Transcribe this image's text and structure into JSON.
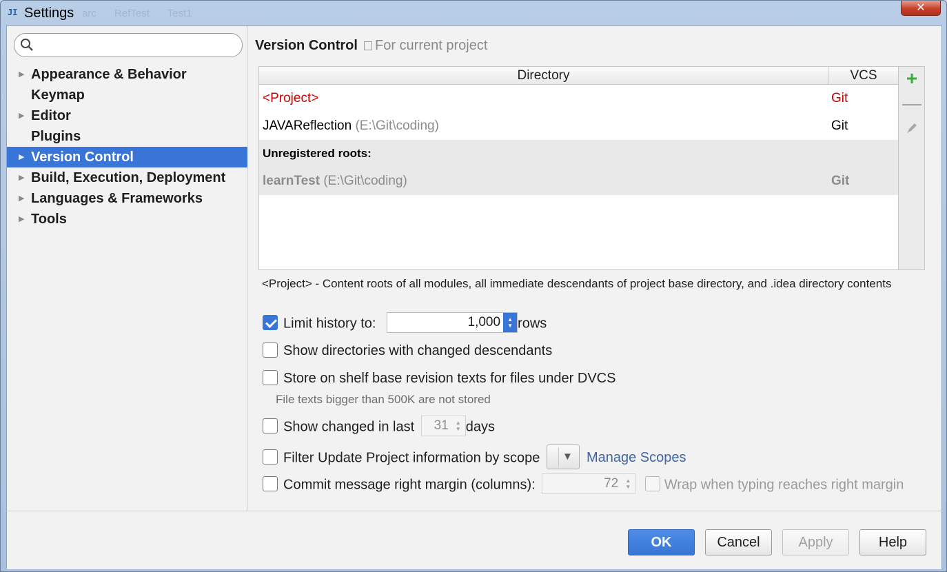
{
  "window": {
    "app_icon": "JI",
    "title": "Settings",
    "background_tabs": [
      "arc",
      "RefTest",
      "Test1"
    ],
    "close_glyph": "✕"
  },
  "sidebar": {
    "search": {
      "value": "",
      "placeholder": ""
    },
    "items": [
      {
        "label": "Appearance & Behavior",
        "expandable": true,
        "selected": false
      },
      {
        "label": "Keymap",
        "expandable": false,
        "selected": false
      },
      {
        "label": "Editor",
        "expandable": true,
        "selected": false
      },
      {
        "label": "Plugins",
        "expandable": false,
        "selected": false
      },
      {
        "label": "Version Control",
        "expandable": true,
        "selected": true
      },
      {
        "label": "Build, Execution, Deployment",
        "expandable": true,
        "selected": false
      },
      {
        "label": "Languages & Frameworks",
        "expandable": true,
        "selected": false
      },
      {
        "label": "Tools",
        "expandable": true,
        "selected": false
      }
    ]
  },
  "main": {
    "heading": "Version Control",
    "scope_label": "For current project",
    "table": {
      "col_directory": "Directory",
      "col_vcs": "VCS",
      "rows": [
        {
          "directory": "<Project>",
          "path": "",
          "vcs": "Git"
        },
        {
          "directory": "JAVAReflection",
          "path": "(E:\\Git\\coding)",
          "vcs": "Git"
        }
      ],
      "unregistered_label": "Unregistered roots:",
      "unregistered_rows": [
        {
          "directory": "learnTest",
          "path": "(E:\\Git\\coding)",
          "vcs": "Git"
        }
      ]
    },
    "table_tools": {
      "add": "+",
      "remove": "—"
    },
    "note": "<Project> - Content roots of all modules, all immediate descendants of project base directory, and .idea directory contents",
    "options": {
      "limit_history": {
        "label": "Limit history to:",
        "checked": true,
        "value": "1,000",
        "suffix": "rows"
      },
      "show_dirs": {
        "label": "Show directories with changed descendants",
        "checked": false
      },
      "store_shelf": {
        "label": "Store on shelf base revision texts for files under DVCS",
        "checked": false,
        "hint": "File texts bigger than 500K are not stored"
      },
      "show_changed": {
        "label": "Show changed in last",
        "checked": false,
        "value": "31",
        "suffix": "days"
      },
      "filter_update": {
        "label": "Filter Update Project information by scope",
        "checked": false,
        "selected_scope": "",
        "link": "Manage Scopes"
      },
      "commit_margin": {
        "label": "Commit message right margin (columns):",
        "checked": false,
        "value": "72",
        "wrap_label": "Wrap when typing reaches right margin",
        "wrap_checked": false
      }
    }
  },
  "footer": {
    "ok": "OK",
    "cancel": "Cancel",
    "apply": "Apply",
    "help": "Help"
  },
  "colors": {
    "accent": "#3875d6",
    "project_red": "#cc0000",
    "add_green": "#3daa3d",
    "link": "#3f65a5"
  }
}
